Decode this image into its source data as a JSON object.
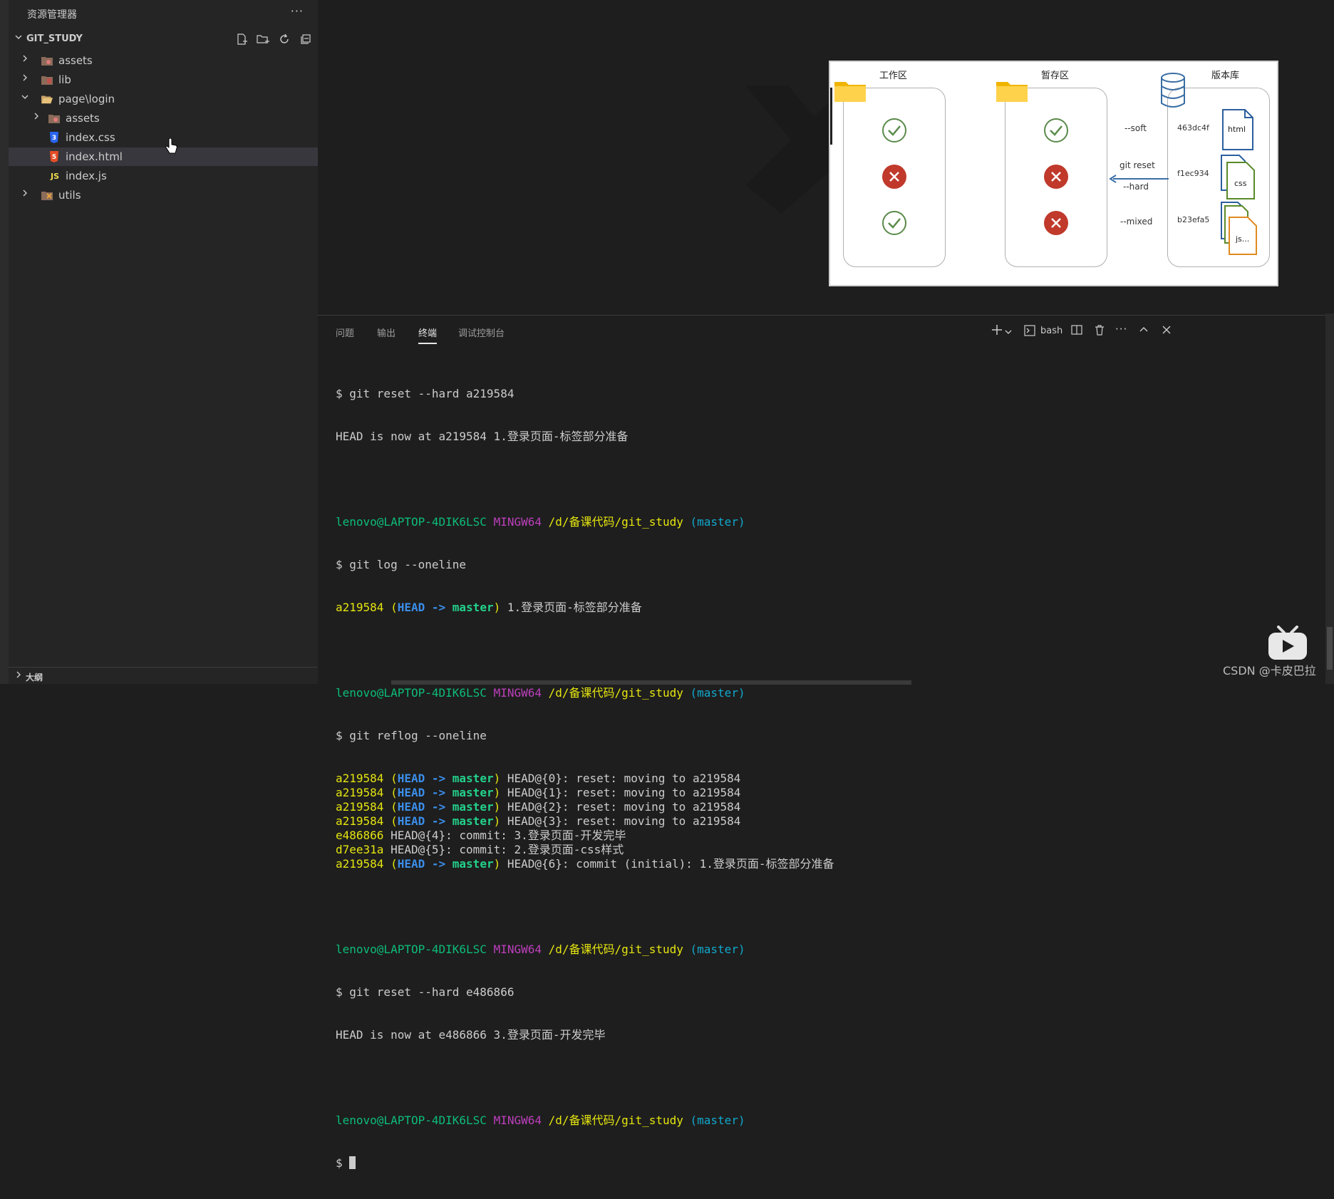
{
  "sidebar": {
    "title": "资源管理器",
    "more": "···",
    "project": "GIT_STUDY",
    "items": [
      {
        "label": "assets"
      },
      {
        "label": "lib"
      },
      {
        "label": "page\\login"
      },
      {
        "label": "assets"
      },
      {
        "label": "index.css"
      },
      {
        "label": "index.html"
      },
      {
        "label": "index.js"
      },
      {
        "label": "utils"
      }
    ],
    "outline": "大纲"
  },
  "icons": {
    "new_file": "new-file-icon",
    "new_folder": "new-folder-icon",
    "refresh": "refresh-icon",
    "collapse": "collapse-all-icon",
    "css_badge": "3",
    "html_badge": "5",
    "js_badge": "JS"
  },
  "diagram": {
    "col1": "工作区",
    "col2": "暂存区",
    "col3": "版本库",
    "soft": "--soft",
    "reset": "git reset",
    "hard": "--hard",
    "mixed": "--mixed",
    "commits": [
      "463dc4f",
      "f1ec934",
      "b23efa5"
    ],
    "files": [
      "html",
      "css",
      "js..."
    ]
  },
  "panel": {
    "tabs": [
      "问题",
      "输出",
      "终端",
      "调试控制台"
    ],
    "active_tab": "终端",
    "shell": "bash"
  },
  "terminal": {
    "prompt_user": "lenovo@LAPTOP-4DIK6LSC",
    "prompt_env": "MINGW64",
    "prompt_path": "/d/备课代码/git_study",
    "prompt_branch": "(master)",
    "head_master": "(HEAD -> master)",
    "cmd1": "$ git reset --hard a219584",
    "out1": "HEAD is now at a219584 1.登录页面-标签部分准备",
    "cmd2": "$ git log --oneline",
    "log_hash": "a219584",
    "log_msg": " 1.登录页面-标签部分准备",
    "cmd3": "$ git reflog --oneline",
    "reflog": [
      {
        "hash": "a219584",
        "head": true,
        "msg": " HEAD@{0}: reset: moving to a219584"
      },
      {
        "hash": "a219584",
        "head": true,
        "msg": " HEAD@{1}: reset: moving to a219584"
      },
      {
        "hash": "a219584",
        "head": true,
        "msg": " HEAD@{2}: reset: moving to a219584"
      },
      {
        "hash": "a219584",
        "head": true,
        "msg": " HEAD@{3}: reset: moving to a219584"
      },
      {
        "hash": "e486866",
        "head": false,
        "msg": " HEAD@{4}: commit: 3.登录页面-开发完毕"
      },
      {
        "hash": "d7ee31a",
        "head": false,
        "msg": " HEAD@{5}: commit: 2.登录页面-css样式"
      },
      {
        "hash": "a219584",
        "head": true,
        "msg": " HEAD@{6}: commit (initial): 1.登录页面-标签部分准备"
      }
    ],
    "cmd4": "$ git reset --hard e486866",
    "out4": "HEAD is now at e486866 3.登录页面-开发完毕",
    "final_prompt": "$ "
  },
  "overlay": {
    "watermark": "CSDN @卡皮巴拉"
  }
}
